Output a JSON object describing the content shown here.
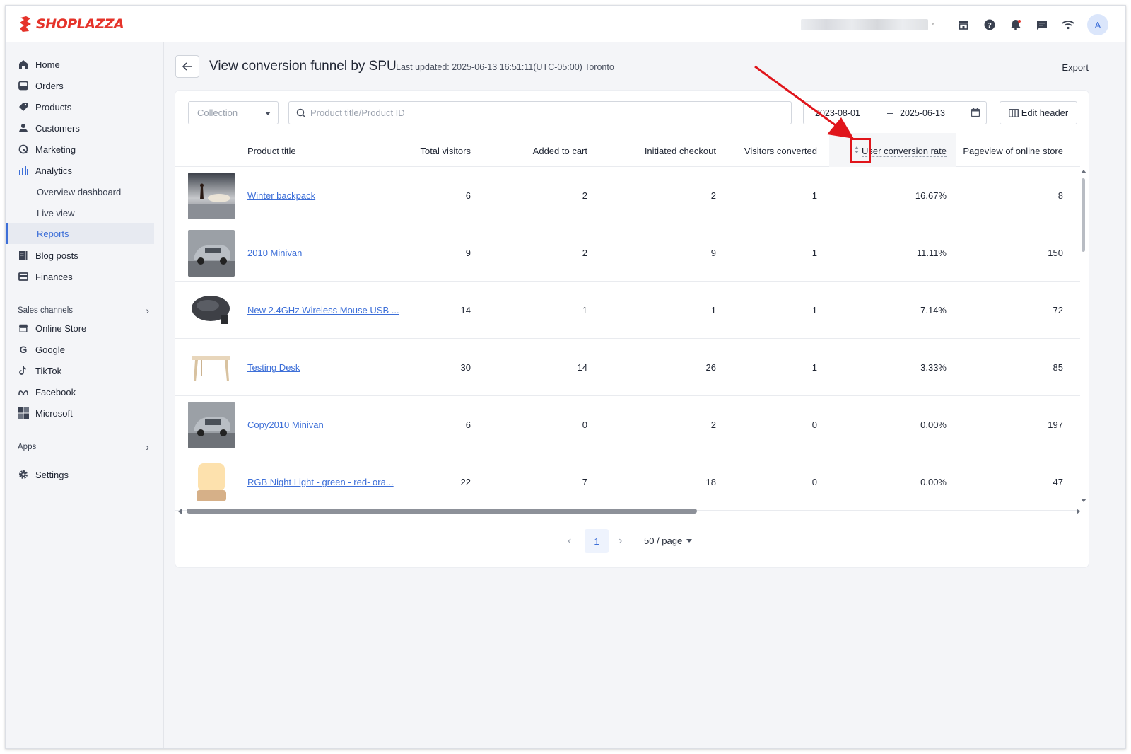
{
  "brand": {
    "logo_text": "SHOPLAZZA",
    "accent": "#3d6fd8",
    "logo_color": "#e5332a"
  },
  "topbar": {
    "icons": [
      "store-icon",
      "help-icon",
      "bell-icon",
      "message-icon",
      "wifi-icon"
    ],
    "avatar_letter": "A"
  },
  "sidebar": {
    "items": [
      {
        "label": "Home",
        "icon": "home-icon"
      },
      {
        "label": "Orders",
        "icon": "orders-icon"
      },
      {
        "label": "Products",
        "icon": "tag-icon"
      },
      {
        "label": "Customers",
        "icon": "user-icon"
      },
      {
        "label": "Marketing",
        "icon": "marketing-icon"
      },
      {
        "label": "Analytics",
        "icon": "analytics-icon"
      },
      {
        "label": "Overview dashboard"
      },
      {
        "label": "Live view"
      },
      {
        "label": "Reports",
        "active": true
      },
      {
        "label": "Blog posts",
        "icon": "blog-icon"
      },
      {
        "label": "Finances",
        "icon": "finances-icon"
      }
    ],
    "sales_channels_label": "Sales channels",
    "channels": [
      {
        "label": "Online Store",
        "icon": "store-icon"
      },
      {
        "label": "Google",
        "icon": "google-icon"
      },
      {
        "label": "TikTok",
        "icon": "tiktok-icon"
      },
      {
        "label": "Facebook",
        "icon": "meta-icon"
      },
      {
        "label": "Microsoft",
        "icon": "microsoft-icon"
      }
    ],
    "apps_label": "Apps",
    "settings_label": "Settings"
  },
  "header": {
    "title": "View conversion funnel by SPU",
    "last_updated": "Last updated: 2025-06-13 16:51:11(UTC-05:00) Toronto",
    "export_label": "Export"
  },
  "filters": {
    "collection_placeholder": "Collection",
    "search_placeholder": "Product title/Product ID",
    "date_start": "2023-08-01",
    "date_end": "2025-06-13",
    "edit_header_label": "Edit header"
  },
  "table": {
    "columns": [
      "Product title",
      "Total visitors",
      "Added to cart",
      "Initiated checkout",
      "Visitors converted",
      "User conversion rate",
      "Pageview of online store"
    ],
    "rows": [
      {
        "title": "Winter backpack",
        "total_visitors": "6",
        "added_to_cart": "2",
        "initiated_checkout": "2",
        "visitors_converted": "1",
        "conversion_rate": "16.67%",
        "pageviews": "8",
        "thumb": "person-on-ice"
      },
      {
        "title": "2010 Minivan",
        "total_visitors": "9",
        "added_to_cart": "2",
        "initiated_checkout": "9",
        "visitors_converted": "1",
        "conversion_rate": "11.11%",
        "pageviews": "150",
        "thumb": "silver-minivan"
      },
      {
        "title": "New 2.4GHz Wireless Mouse USB ...",
        "total_visitors": "14",
        "added_to_cart": "1",
        "initiated_checkout": "1",
        "visitors_converted": "1",
        "conversion_rate": "7.14%",
        "pageviews": "72",
        "thumb": "black-mouse"
      },
      {
        "title": "Testing Desk",
        "total_visitors": "30",
        "added_to_cart": "14",
        "initiated_checkout": "26",
        "visitors_converted": "1",
        "conversion_rate": "3.33%",
        "pageviews": "85",
        "thumb": "wooden-desk"
      },
      {
        "title": "Copy2010 Minivan",
        "total_visitors": "6",
        "added_to_cart": "0",
        "initiated_checkout": "2",
        "visitors_converted": "0",
        "conversion_rate": "0.00%",
        "pageviews": "197",
        "thumb": "silver-minivan"
      },
      {
        "title": "RGB Night Light - green - red- ora...",
        "total_visitors": "22",
        "added_to_cart": "7",
        "initiated_checkout": "18",
        "visitors_converted": "0",
        "conversion_rate": "0.00%",
        "pageviews": "47",
        "thumb": "night-lamp"
      }
    ]
  },
  "pagination": {
    "current_page": "1",
    "page_size": "50 / page"
  },
  "annotation": {
    "color": "#e0151b",
    "target": "sort-icon-user-conversion-rate"
  }
}
